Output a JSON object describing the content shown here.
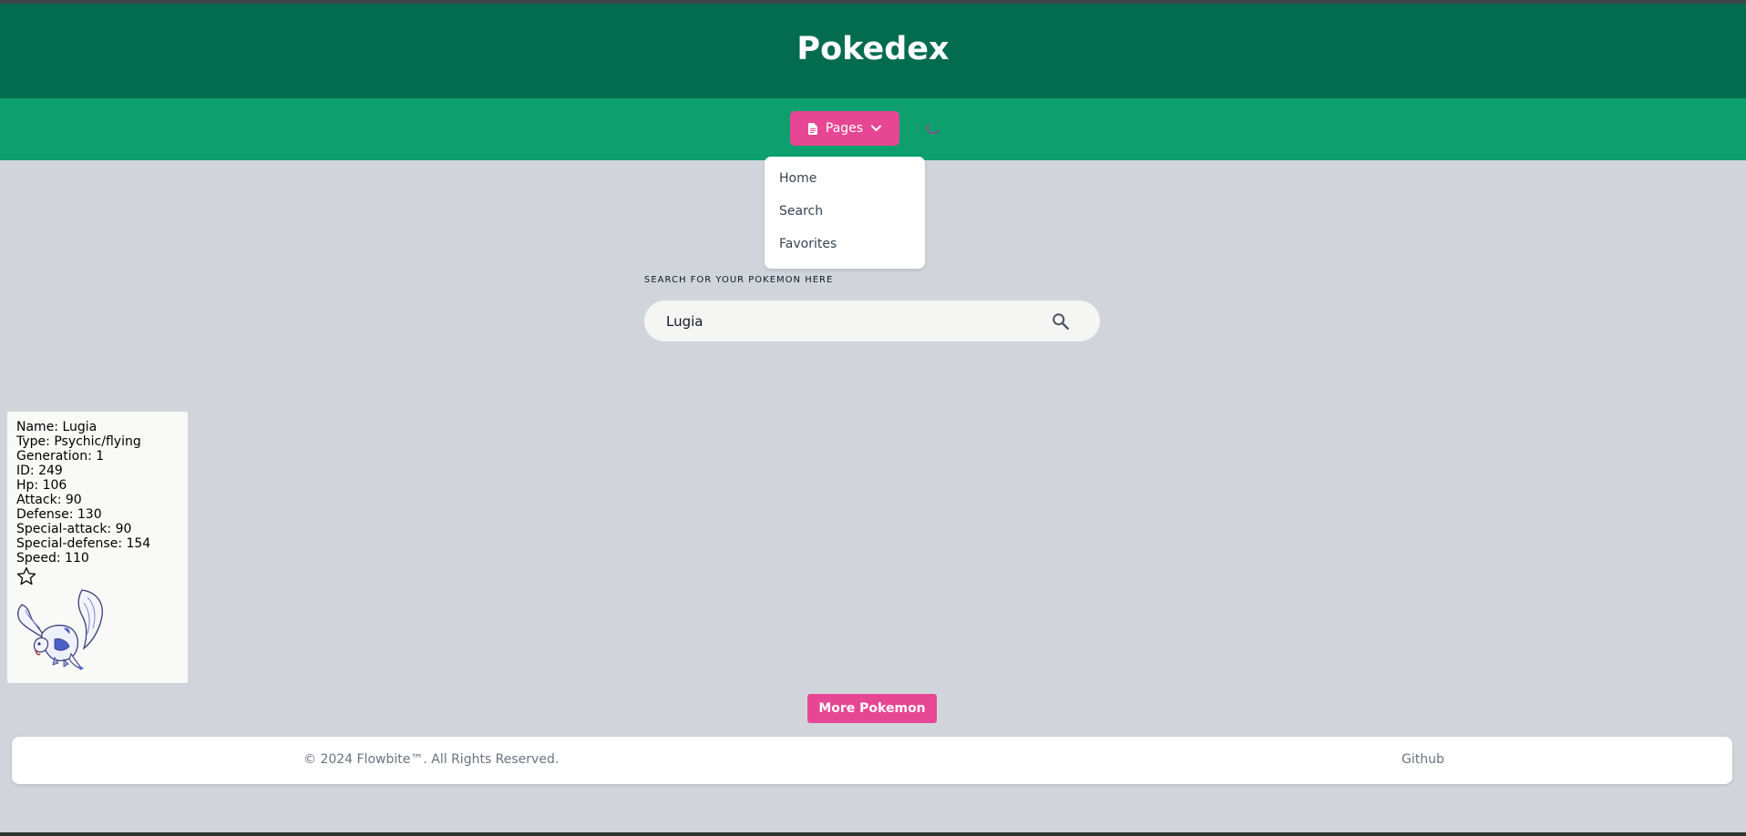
{
  "header": {
    "title": "Pokedex"
  },
  "nav": {
    "pages_label": "Pages",
    "menu": [
      {
        "label": "Home"
      },
      {
        "label": "Search"
      },
      {
        "label": "Favorites"
      }
    ]
  },
  "search": {
    "label": "SEARCH FOR YOUR POKEMON HERE",
    "value": "Lugia"
  },
  "pokemon": {
    "lines": [
      "Name: Lugia",
      "Type: Psychic/flying",
      "Generation: 1",
      "ID: 249",
      "Hp: 106",
      "Attack: 90",
      "Defense: 130",
      "Special-attack: 90",
      "Special-defense: 154",
      "Speed: 110"
    ],
    "favorited": false
  },
  "more_button": {
    "label": "More Pokemon"
  },
  "footer": {
    "copyright": "© 2024 Flowbite™. All Rights Reserved.",
    "github": "Github"
  },
  "colors": {
    "header": "#046c4e",
    "navbar": "#0e9f6e",
    "accent": "#e74694",
    "background": "#d1d5db"
  }
}
